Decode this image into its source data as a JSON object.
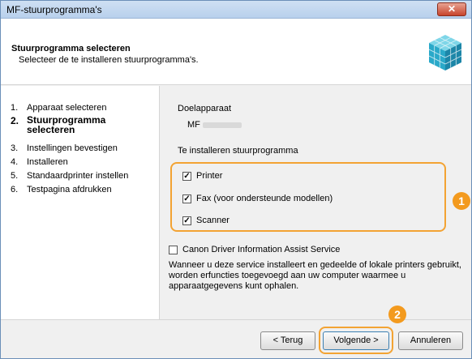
{
  "window": {
    "title": "MF-stuurprogramma's",
    "close_label": "✕"
  },
  "header": {
    "title": "Stuurprogramma selecteren",
    "subtitle": "Selecteer de te installeren stuurprogramma's."
  },
  "steps": [
    {
      "num": "1.",
      "label": "Apparaat selecteren"
    },
    {
      "num": "2.",
      "label": "Stuurprogramma selecteren"
    },
    {
      "num": "3.",
      "label": "Instellingen bevestigen"
    },
    {
      "num": "4.",
      "label": "Installeren"
    },
    {
      "num": "5.",
      "label": "Standaardprinter instellen"
    },
    {
      "num": "6.",
      "label": "Testpagina afdrukken"
    }
  ],
  "main": {
    "device_heading": "Doelapparaat",
    "device_name": "MF",
    "drivers_heading": "Te installeren stuurprogramma",
    "drivers": [
      {
        "label": "Printer",
        "checked": true
      },
      {
        "label": "Fax (voor ondersteunde modellen)",
        "checked": true
      },
      {
        "label": "Scanner",
        "checked": true
      }
    ],
    "assist_service": {
      "label": "Canon Driver Information Assist Service",
      "checked": false
    },
    "info_text": "Wanneer u deze service installeert en gedeelde of lokale printers gebruikt, worden erfuncties toegevoegd aan uw computer waarmee u apparaatgegevens kunt ophalen."
  },
  "callouts": {
    "one": "1",
    "two": "2"
  },
  "footer": {
    "back_label": "< Terug",
    "next_label": "Volgende >",
    "cancel_label": "Annuleren"
  },
  "colors": {
    "accent_orange": "#f39a1e",
    "title_bar": "#cfe0f3",
    "close_red": "#c7442c"
  }
}
